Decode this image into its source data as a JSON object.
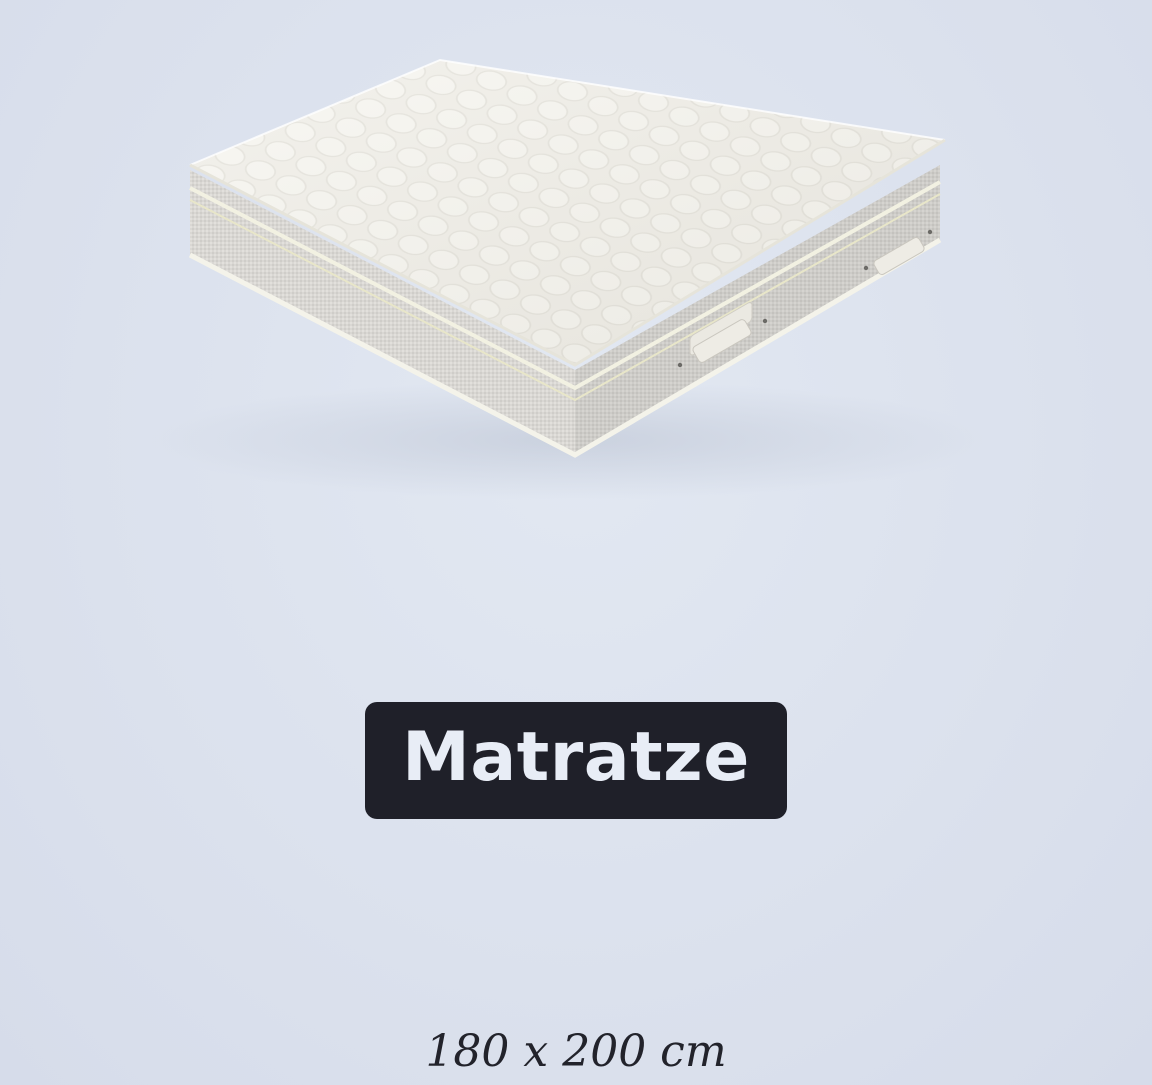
{
  "product": {
    "image_icon": "mattress-image",
    "title": "Matratze",
    "size": "180 x 200 cm"
  },
  "colors": {
    "background": "#dde3ee",
    "pill": "#1f2029",
    "pill_text": "#e8edf6",
    "size_text": "#22232b"
  }
}
